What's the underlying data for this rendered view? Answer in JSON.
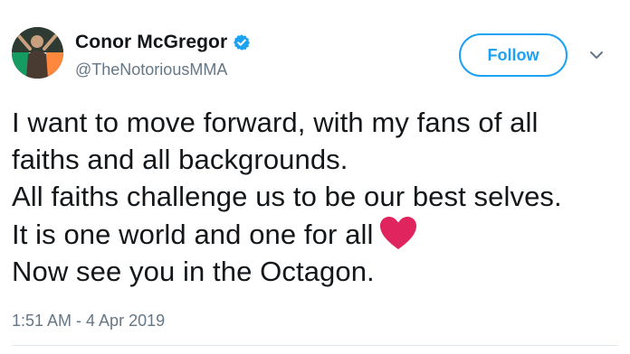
{
  "user": {
    "display_name": "Conor McGregor",
    "handle": "@TheNotoriousMMA",
    "verified": true
  },
  "actions": {
    "follow_label": "Follow",
    "menu_icon": "chevron-down-icon"
  },
  "tweet": {
    "lines": [
      "I want to move forward, with my fans of all",
      "faiths and all backgrounds.",
      "All faiths challenge us to be our best selves.",
      "It is one world and one for all",
      "Now see you in the Octagon."
    ],
    "emoji": "heart-icon",
    "timestamp": "1:51 AM - 4 Apr 2019"
  },
  "colors": {
    "accent": "#1da1f2",
    "text": "#14171a",
    "secondary_text": "#657786",
    "heart": "#e0245e",
    "divider": "#e1e8ed"
  }
}
